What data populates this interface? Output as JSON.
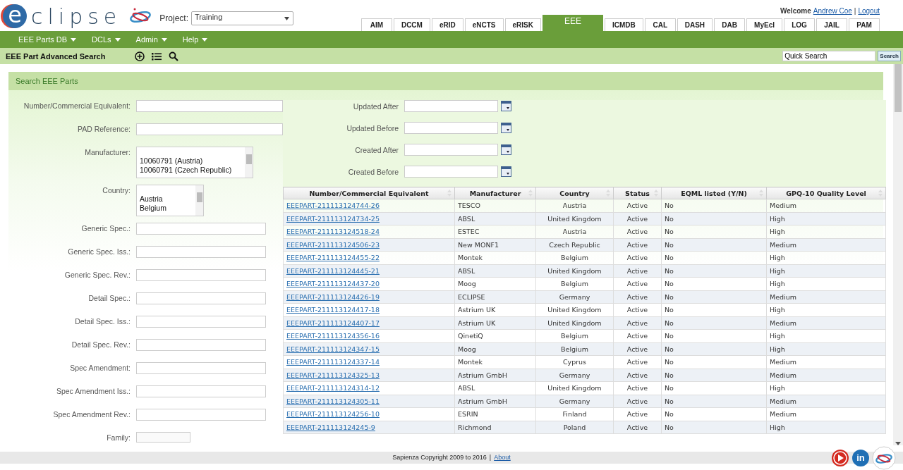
{
  "logo": {
    "initial": "e",
    "rest": "clipse"
  },
  "project": {
    "label": "Project:",
    "value": "Training"
  },
  "user": {
    "welcome": "Welcome",
    "name": "Andrew Coe",
    "separator": "|",
    "logout": "Logout"
  },
  "tabs": [
    {
      "label": "AIM",
      "selected": false
    },
    {
      "label": "DCCM",
      "selected": false
    },
    {
      "label": "eRID",
      "selected": false
    },
    {
      "label": "eNCTS",
      "selected": false
    },
    {
      "label": "eRISK",
      "selected": false
    },
    {
      "label": "EEE",
      "selected": true
    },
    {
      "label": "ICMDB",
      "selected": false
    },
    {
      "label": "CAL",
      "selected": false
    },
    {
      "label": "DASH",
      "selected": false
    },
    {
      "label": "DAB",
      "selected": false
    },
    {
      "label": "MyEcl",
      "selected": false
    },
    {
      "label": "LOG",
      "selected": false
    },
    {
      "label": "JAIL",
      "selected": false
    },
    {
      "label": "PAM",
      "selected": false
    }
  ],
  "menu": [
    "EEE Parts DB",
    "DCLs",
    "Admin",
    "Help"
  ],
  "page_title": "EEE Part Advanced Search",
  "quick_search": {
    "value": "Quick Search",
    "button": "Search"
  },
  "panel_title": "Search EEE Parts",
  "left_fields": [
    {
      "kind": "text",
      "label": "Number/Commercial Equivalent:"
    },
    {
      "kind": "text",
      "label": "PAD Reference:"
    },
    {
      "kind": "listbox",
      "label": "Manufacturer:",
      "options": [
        "10060791 (Austria)",
        "10060791 (Czech Republic)"
      ]
    },
    {
      "kind": "listbox",
      "label": "Country:",
      "options": [
        "Austria",
        "Belgium"
      ]
    },
    {
      "kind": "text",
      "label": "Generic Spec.:"
    },
    {
      "kind": "text",
      "label": "Generic Spec. Iss.:"
    },
    {
      "kind": "text",
      "label": "Generic Spec. Rev.:"
    },
    {
      "kind": "text",
      "label": "Detail Spec.:"
    },
    {
      "kind": "text",
      "label": "Detail Spec. Iss.:"
    },
    {
      "kind": "text",
      "label": "Detail Spec. Rev.:"
    },
    {
      "kind": "text",
      "label": "Spec Amendment:"
    },
    {
      "kind": "text",
      "label": "Spec Amendment Iss.:"
    },
    {
      "kind": "text",
      "label": "Spec Amendment Rev.:"
    },
    {
      "kind": "select",
      "label": "Family:"
    }
  ],
  "date_fields": [
    "Updated After",
    "Updated Before",
    "Created After",
    "Created Before"
  ],
  "table": {
    "columns": [
      "Number/Commercial Equivalent",
      "Manufacturer",
      "Country",
      "Status",
      "EQML listed (Y/N)",
      "GPQ-10 Quality Level"
    ],
    "rows": [
      [
        "EEEPART-211113124744-26",
        "TESCO",
        "Austria",
        "Active",
        "No",
        "Medium"
      ],
      [
        "EEEPART-211113124734-25",
        "ABSL",
        "United Kingdom",
        "Active",
        "No",
        "High"
      ],
      [
        "EEEPART-211113124518-24",
        "ESTEC",
        "Austria",
        "Active",
        "No",
        "High"
      ],
      [
        "EEEPART-211113124506-23",
        "New MONF1",
        "Czech Republic",
        "Active",
        "No",
        "Medium"
      ],
      [
        "EEEPART-211113124455-22",
        "Montek",
        "Belgium",
        "Active",
        "No",
        "High"
      ],
      [
        "EEEPART-211113124445-21",
        "ABSL",
        "United Kingdom",
        "Active",
        "No",
        "High"
      ],
      [
        "EEEPART-211113124437-20",
        "Moog",
        "Belgium",
        "Active",
        "No",
        "High"
      ],
      [
        "EEEPART-211113124426-19",
        "ECLIPSE",
        "Germany",
        "Active",
        "No",
        "Medium"
      ],
      [
        "EEEPART-211113124417-18",
        "Astrium UK",
        "United Kingdom",
        "Active",
        "No",
        "High"
      ],
      [
        "EEEPART-211113124407-17",
        "Astrium UK",
        "United Kingdom",
        "Active",
        "No",
        "Medium"
      ],
      [
        "EEEPART-211113124356-16",
        "QinetiQ",
        "Belgium",
        "Active",
        "No",
        "High"
      ],
      [
        "EEEPART-211113124347-15",
        "Moog",
        "Belgium",
        "Active",
        "No",
        "High"
      ],
      [
        "EEEPART-211113124337-14",
        "Montek",
        "Cyprus",
        "Active",
        "No",
        "Medium"
      ],
      [
        "EEEPART-211113124325-13",
        "Astrium GmbH",
        "Germany",
        "Active",
        "No",
        "Medium"
      ],
      [
        "EEEPART-211113124314-12",
        "ABSL",
        "United Kingdom",
        "Active",
        "No",
        "High"
      ],
      [
        "EEEPART-211113124305-11",
        "Astrium GmbH",
        "Germany",
        "Active",
        "No",
        "Medium"
      ],
      [
        "EEEPART-211113124256-10",
        "ESRIN",
        "Finland",
        "Active",
        "No",
        "Medium"
      ],
      [
        "EEEPART-211113124245-9",
        "Richmond",
        "Poland",
        "Active",
        "No",
        "High"
      ]
    ]
  },
  "footer": {
    "copyright": "Sapienza Copyright 2009 to 2016",
    "separator": "|",
    "link": "About",
    "linkedin": "in"
  }
}
